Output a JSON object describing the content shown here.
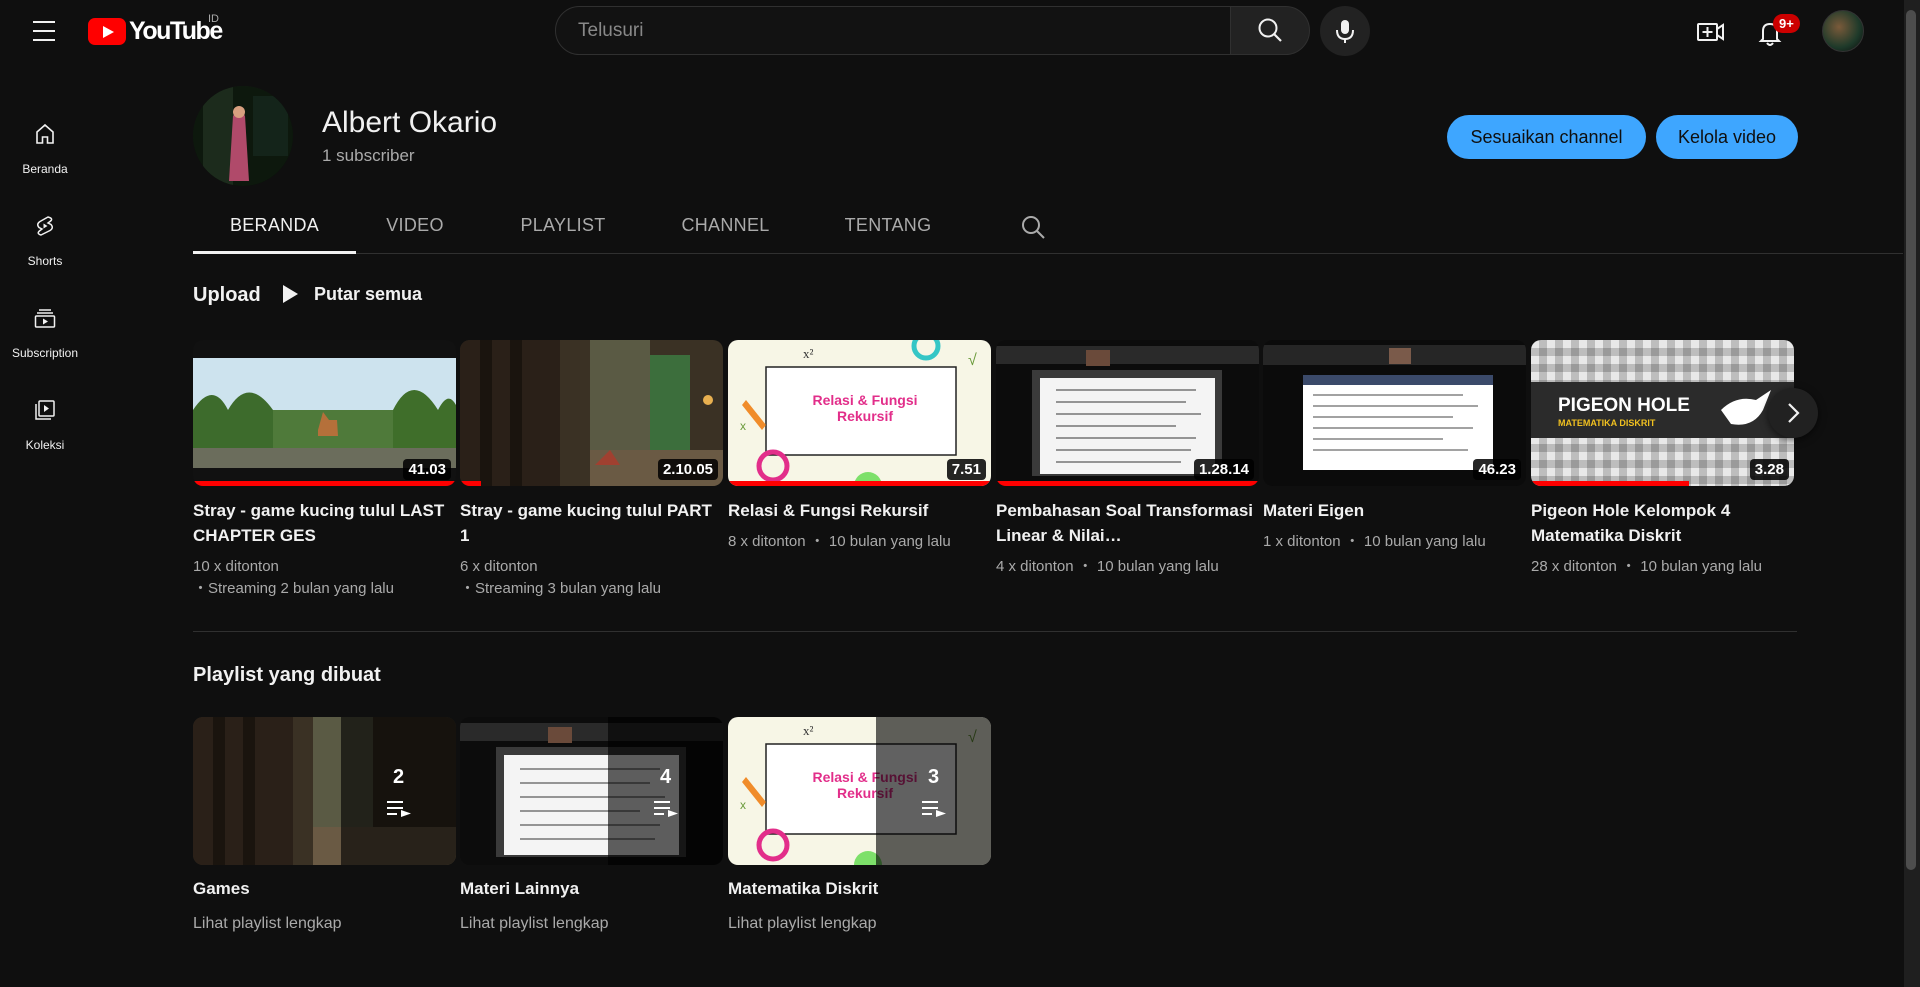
{
  "masthead": {
    "logo_text": "YouTube",
    "country_code": "ID",
    "search_placeholder": "Telusuri",
    "notification_badge": "9+"
  },
  "sidebar": {
    "items": [
      {
        "label": "Beranda",
        "icon": "home-icon"
      },
      {
        "label": "Shorts",
        "icon": "shorts-icon"
      },
      {
        "label": "Subscription",
        "icon": "subscriptions-icon"
      },
      {
        "label": "Koleksi",
        "icon": "library-icon"
      }
    ]
  },
  "channel": {
    "name": "Albert Okario",
    "subscribers": "1 subscriber",
    "customize_label": "Sesuaikan channel",
    "manage_label": "Kelola video"
  },
  "tabs": [
    "BERANDA",
    "VIDEO",
    "PLAYLIST",
    "CHANNEL",
    "TENTANG"
  ],
  "uploads": {
    "title": "Upload",
    "play_all": "Putar semua",
    "videos": [
      {
        "title": "Stray - game kucing tulul LAST CHAPTER GES",
        "duration": "41.03",
        "meta1": "10 x ditonton",
        "meta2": "・Streaming 2 bulan yang lalu",
        "progress": 1.0
      },
      {
        "title": "Stray - game kucing tulul PART 1",
        "duration": "2.10.05",
        "meta1": "6 x ditonton",
        "meta2": "・Streaming 3 bulan yang lalu",
        "progress": 0.08
      },
      {
        "title": "Relasi & Fungsi Rekursif",
        "duration": "7.51",
        "meta1": "8 x ditonton ・ 10 bulan yang lalu",
        "meta2": "",
        "progress": 1.0
      },
      {
        "title": "Pembahasan Soal Transformasi Linear & Nilai…",
        "duration": "1.28.14",
        "meta1": "4 x ditonton ・ 10 bulan yang lalu",
        "meta2": "",
        "progress": 1.0
      },
      {
        "title": "Materi Eigen",
        "duration": "46.23",
        "meta1": "1 x ditonton ・ 10 bulan yang lalu",
        "meta2": "",
        "progress": 0.0
      },
      {
        "title": "Pigeon Hole Kelompok 4 Matematika Diskrit",
        "duration": "3.28",
        "meta1": "28 x ditonton ・ 10 bulan yang lalu",
        "meta2": "",
        "progress": 0.6
      }
    ],
    "thumb_texts": {
      "relasi": "Relasi & Fungsi Rekursif",
      "pigeon_title": "PIGEON HOLE",
      "pigeon_sub": "MATEMATIKA DISKRIT"
    }
  },
  "playlists": {
    "title": "Playlist yang dibuat",
    "items": [
      {
        "title": "Games",
        "count": "2",
        "link": "Lihat playlist lengkap"
      },
      {
        "title": "Materi Lainnya",
        "count": "4",
        "link": "Lihat playlist lengkap"
      },
      {
        "title": "Matematika Diskrit",
        "count": "3",
        "link": "Lihat playlist lengkap"
      }
    ]
  }
}
